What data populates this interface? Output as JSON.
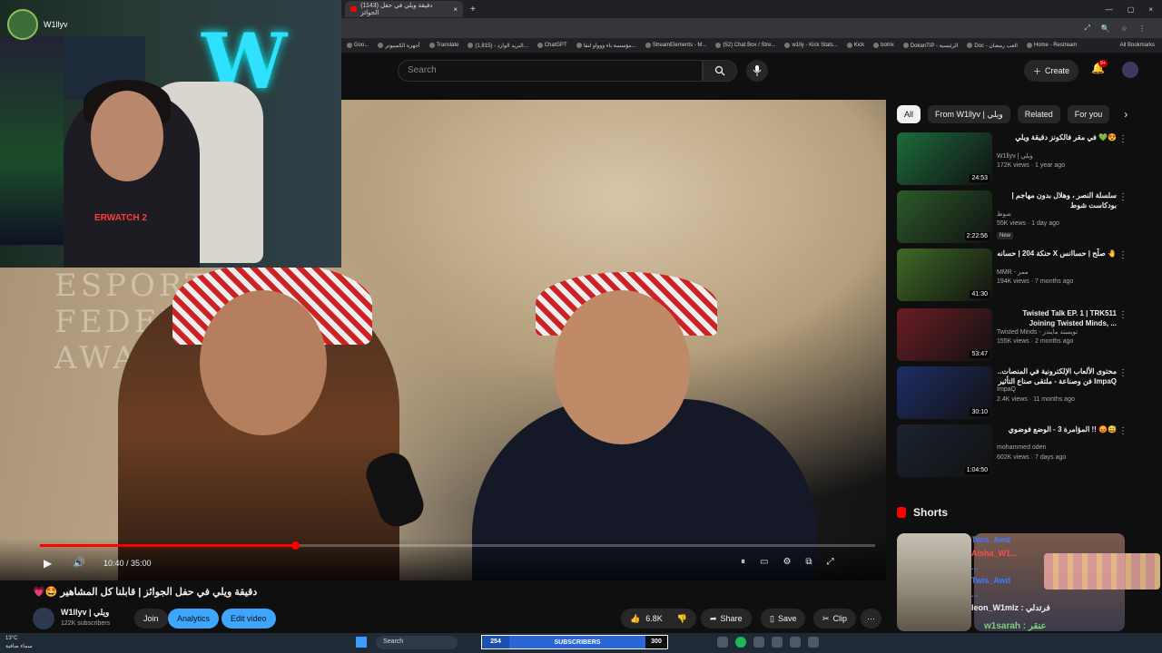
{
  "browser": {
    "tab_title": "(1143) دقيقة ويلي في حفل الجوائز",
    "tab_close": "×",
    "new_tab": "+",
    "window_controls": [
      "—",
      "▢",
      "×"
    ],
    "omnibox_icons": [
      "⤢",
      "🔍",
      "☆",
      "⋮"
    ],
    "bookmarks": [
      "Goo...",
      "أجهزة الكمبيوتر",
      "Translate",
      "البريد الوارد - (1,815)...",
      "ChatGPT",
      "مؤسسة باء ووواو لتقا...",
      "StreamElements - M...",
      "(52) Chat Box / Stre...",
      "w1lly - Kick Stats...",
      "Kick",
      "botrix",
      "DokanTIP - الرئيسية",
      "Doc - العب رمضان",
      "Home - Restream"
    ],
    "all_bookmarks": "All Bookmarks"
  },
  "yt_header": {
    "search_placeholder": "Search",
    "create_label": "Create",
    "notif_badge": "9+"
  },
  "webcam": {
    "username": "W1llyv",
    "logo_text": "W",
    "shirt_text": "ERWATCH 2"
  },
  "video": {
    "background_text": "ESPORTS\nFEDERATION\nAWARDS",
    "time": "10:40 / 35:00",
    "progress": 0.305
  },
  "chips": [
    "All",
    "From W1llyv | ويلي",
    "Related",
    "For you"
  ],
  "recommendations": [
    {
      "title": "في مقر فالكونز دقيقة ويلي 💚😍",
      "channel": "W1llyv | ويلي",
      "meta": "172K views · 1 year ago",
      "duration": "24:53",
      "color": "#1c6b3c"
    },
    {
      "title": "سلسلة النصر ، وهلال بدون مهاجم | بودكاست شوط",
      "channel": "شوط",
      "meta": "55K views · 1 day ago",
      "duration": "2:22:56",
      "new": "New",
      "color": "#2c5a2a"
    },
    {
      "title": "حنكة 204 | حسانه X صلّح | حساانس 🤚",
      "channel": "MMR - ممر",
      "meta": "194K views · 7 months ago",
      "duration": "41:30",
      "color": "#3f6a25"
    },
    {
      "title": "Twisted Talk EP. 1 | TRK511 Joining Twisted Minds, ...",
      "channel": "Twisted Minds - تويستد مايندز",
      "meta": "155K views · 2 months ago",
      "duration": "53:47",
      "color": "#6b1d24"
    },
    {
      "title": "محتوى الألعاب الإلكترونية في المنصات.. فن وصناعة - ملتقى صناع التأثير ImpaQ",
      "channel": "ImpaQ",
      "meta": "2.4K views · 11 months ago",
      "duration": "30:10",
      "color": "#1e2d66"
    },
    {
      "title": "المؤامرة 3 - الوضع فوضوي !! 😡😅",
      "channel": "mohammed oden",
      "meta": "602K views · 7 days ago",
      "duration": "1:04:50",
      "color": "#1b2330"
    }
  ],
  "shorts": {
    "title": "Shorts"
  },
  "chat": {
    "lines": [
      "Twis_Awd",
      "Aisha_W1...",
      "...",
      "Twis_Awd",
      "...",
      "leon_W1mlz : فرتدلي"
    ],
    "bottom": "w1sarah : عنقر"
  },
  "below_video": {
    "title": "💗🤩 دقيقة ويلي في حفل الجوائز | قابلنا كل المشاهير",
    "channel_name": "W1llyv | ويلي",
    "subscribers": "122K subscribers",
    "join": "Join",
    "analytics": "Analytics",
    "edit_video": "Edit video",
    "likes": "6.8K",
    "share": "Share",
    "save": "Save",
    "clip": "Clip"
  },
  "taskbar": {
    "weather_temp": "13°C",
    "weather_desc": "سماء صافية",
    "search": "Search",
    "sub_left": "254",
    "sub_label": "SUBSCRIBERS",
    "sub_right": "300"
  }
}
